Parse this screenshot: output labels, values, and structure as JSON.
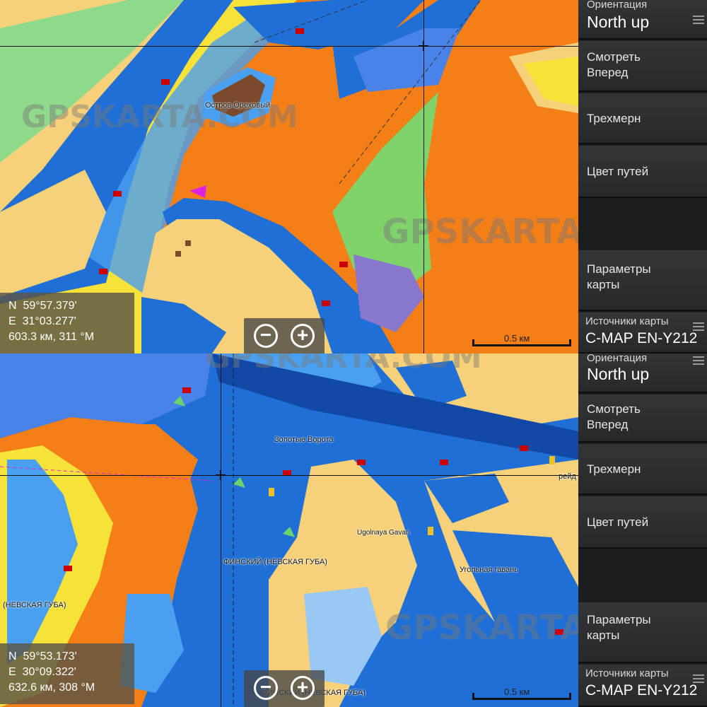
{
  "top_pane": {
    "menu": {
      "orientation_label": "Ориентация",
      "orientation_value": "North up",
      "look_ahead": "Смотреть\nВперед",
      "three_d": "Трехмерн",
      "track_colors": "Цвет путей",
      "chart_params": "Параметры\nкарты",
      "chart_source_label": "Источники карты",
      "chart_source_value": "C-MAP EN-Y212"
    },
    "coords": {
      "lat": "N  59°57.379'",
      "lon": "E  31°03.277'",
      "range": "603.3 км, 311 °M"
    },
    "scale": "0.5 км",
    "labels": {
      "island": "Остров Ореховый"
    }
  },
  "bottom_pane": {
    "menu": {
      "orientation_label": "Ориентация",
      "orientation_value": "North up",
      "look_ahead": "Смотреть\nВперед",
      "three_d": "Трехмерн",
      "track_colors": "Цвет путей",
      "chart_params": "Параметры\nкарты",
      "chart_source_label": "Источники карты",
      "chart_source_value": "C-MAP EN-Y212"
    },
    "coords": {
      "lat": "N  59°53.173'",
      "lon": "E  30°09.322'",
      "range": "632.6 км, 308 °M"
    },
    "scale": "0.5 км",
    "labels": {
      "golden_gate": "Золотые Ворота",
      "gulf": "ФИНСКИЙ (НЕВСКАЯ ГУБА)",
      "gulf_left": "(НЕВСКАЯ ГУБА)",
      "gulf_bottom": "ФИНСКИЙ (НЕВСКАЯ ГУБА)",
      "ugolnaya_en": "Ugolnaya Gavan",
      "ugolnaya_ru": "Угольная гавань",
      "reid": "рейд"
    }
  },
  "watermark": "GPSKARTA.COM",
  "colors": {
    "deep_water": "#1f6fd6",
    "mid_water": "#4aa0f0",
    "land": "#f7d17a",
    "shallow_orange": "#f57f17",
    "yellow": "#f7e23a",
    "marsh": "#7fd36a"
  }
}
